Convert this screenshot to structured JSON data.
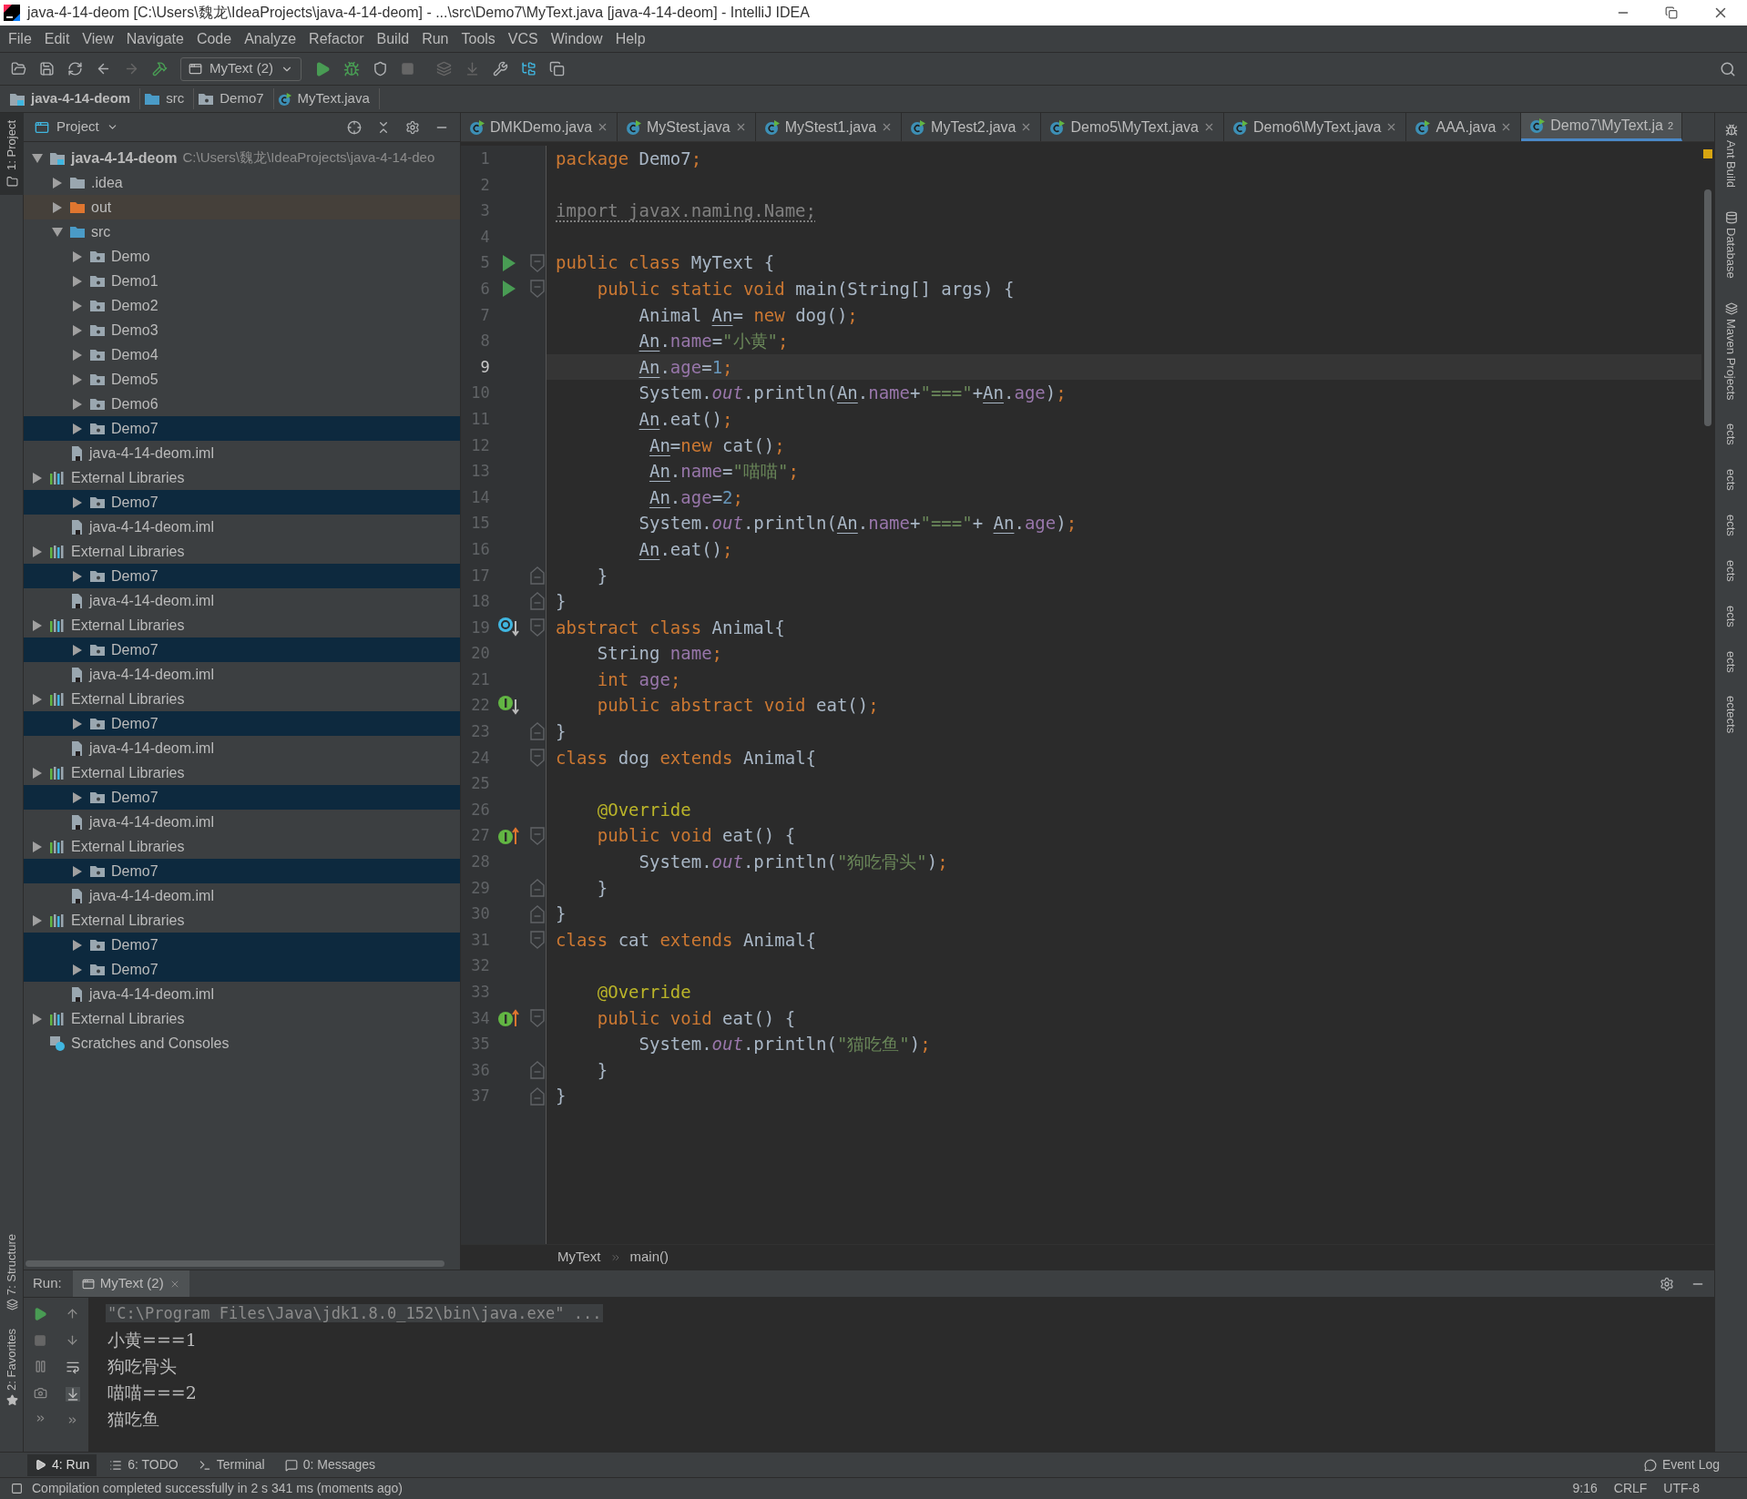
{
  "window": {
    "title": "java-4-14-deom [C:\\Users\\魏龙\\IdeaProjects\\java-4-14-deom] - ...\\src\\Demo7\\MyText.java [java-4-14-deom] - IntelliJ IDEA"
  },
  "menu": [
    "File",
    "Edit",
    "View",
    "Navigate",
    "Code",
    "Analyze",
    "Refactor",
    "Build",
    "Run",
    "Tools",
    "VCS",
    "Window",
    "Help"
  ],
  "toolbar": {
    "run_config": "MyText (2)"
  },
  "nav_bar": [
    {
      "kind": "module",
      "label": "java-4-14-deom"
    },
    {
      "kind": "source",
      "label": "src"
    },
    {
      "kind": "package",
      "label": "Demo7"
    },
    {
      "kind": "class",
      "label": "MyText.java"
    }
  ],
  "left_strip": {
    "top": [
      "1: Project"
    ],
    "bottom": [
      "7: Structure",
      "2: Favorites"
    ]
  },
  "project_panel": {
    "title": "Project",
    "tree": [
      {
        "kind": "root",
        "label": "java-4-14-deom",
        "path": "C:\\Users\\魏龙\\IdeaProjects\\java-4-14-deo",
        "expanded": true,
        "selected": false,
        "children": [
          {
            "kind": "folder",
            "label": ".idea",
            "expanded": false,
            "selected": false
          },
          {
            "kind": "excluded",
            "label": "out",
            "expanded": false,
            "selected": false
          },
          {
            "kind": "source",
            "label": "src",
            "expanded": true,
            "selected": false,
            "children": [
              {
                "kind": "package",
                "label": "Demo",
                "expanded": false,
                "selected": false
              },
              {
                "kind": "package",
                "label": "Demo1",
                "expanded": false,
                "selected": false
              },
              {
                "kind": "package",
                "label": "Demo2",
                "expanded": false,
                "selected": false
              },
              {
                "kind": "package",
                "label": "Demo3",
                "expanded": false,
                "selected": false
              },
              {
                "kind": "package",
                "label": "Demo4",
                "expanded": false,
                "selected": false
              },
              {
                "kind": "package",
                "label": "Demo5",
                "expanded": false,
                "selected": false
              },
              {
                "kind": "package",
                "label": "Demo6",
                "expanded": false,
                "selected": false
              },
              {
                "kind": "package",
                "label": "Demo7",
                "expanded": false,
                "selected": true
              }
            ]
          },
          {
            "kind": "iml",
            "label": "java-4-14-deom.iml",
            "selected": false
          }
        ]
      },
      {
        "kind": "library",
        "label": "External Libraries",
        "expanded": false,
        "selected": false
      },
      {
        "kind": "package",
        "label": "Demo7",
        "expanded": false,
        "selected": true
      },
      {
        "kind": "iml",
        "label": "java-4-14-deom.iml",
        "selected": false
      },
      {
        "kind": "library",
        "label": "External Libraries",
        "expanded": false,
        "selected": false
      },
      {
        "kind": "package",
        "label": "Demo7",
        "expanded": false,
        "selected": true
      },
      {
        "kind": "iml",
        "label": "java-4-14-deom.iml",
        "selected": false
      },
      {
        "kind": "library",
        "label": "External Libraries",
        "expanded": false,
        "selected": false
      },
      {
        "kind": "package",
        "label": "Demo7",
        "expanded": false,
        "selected": true
      },
      {
        "kind": "iml",
        "label": "java-4-14-deom.iml",
        "selected": false
      },
      {
        "kind": "library",
        "label": "External Libraries",
        "expanded": false,
        "selected": false
      },
      {
        "kind": "package",
        "label": "Demo7",
        "expanded": false,
        "selected": true
      },
      {
        "kind": "iml",
        "label": "java-4-14-deom.iml",
        "selected": false
      },
      {
        "kind": "library",
        "label": "External Libraries",
        "expanded": false,
        "selected": false
      },
      {
        "kind": "package",
        "label": "Demo7",
        "expanded": false,
        "selected": true
      },
      {
        "kind": "iml",
        "label": "java-4-14-deom.iml",
        "selected": false
      },
      {
        "kind": "library",
        "label": "External Libraries",
        "expanded": false,
        "selected": false
      },
      {
        "kind": "package",
        "label": "Demo7",
        "expanded": false,
        "selected": true
      },
      {
        "kind": "iml",
        "label": "java-4-14-deom.iml",
        "selected": false
      },
      {
        "kind": "library",
        "label": "External Libraries",
        "expanded": false,
        "selected": false
      },
      {
        "kind": "package",
        "label": "Demo7",
        "expanded": false,
        "selected": true
      },
      {
        "kind": "package",
        "label": "Demo7",
        "expanded": false,
        "selected": true
      },
      {
        "kind": "iml",
        "label": "java-4-14-deom.iml",
        "selected": false
      },
      {
        "kind": "library",
        "label": "External Libraries",
        "expanded": false,
        "selected": false
      },
      {
        "kind": "scratches",
        "label": "Scratches and Consoles",
        "selected": false
      }
    ]
  },
  "editor": {
    "tabs": [
      {
        "label": "DMKDemo.java",
        "selected": false
      },
      {
        "label": "MyStest.java",
        "selected": false
      },
      {
        "label": "MyStest1.java",
        "selected": false
      },
      {
        "label": "MyTest2.java",
        "selected": false
      },
      {
        "label": "Demo5\\MyText.java",
        "selected": false
      },
      {
        "label": "Demo6\\MyText.java",
        "selected": false
      },
      {
        "label": "AAA.java",
        "selected": false
      },
      {
        "label": "Demo7\\MyText.ja",
        "selected": true
      }
    ],
    "tab_overflow": "2",
    "lines": [
      {
        "number": "1",
        "current": false,
        "tokens": [
          {
            "kind": "kw",
            "text": "package"
          },
          {
            "kind": "plain",
            "text": " Demo7"
          },
          {
            "kind": "kw",
            "text": ";"
          }
        ]
      },
      {
        "number": "2",
        "current": false
      },
      {
        "number": "3",
        "current": false,
        "tokens": [
          {
            "kind": "unused",
            "text": "import javax.naming.Name;"
          }
        ]
      },
      {
        "number": "4",
        "current": false
      },
      {
        "number": "5",
        "current": false,
        "gutter_icon": {
          "kind": "run"
        },
        "fold_icon": {
          "kind": "open"
        },
        "tokens": [
          {
            "kind": "kw",
            "text": "public class"
          },
          {
            "kind": "plain",
            "text": " MyText {"
          }
        ]
      },
      {
        "number": "6",
        "current": false,
        "gutter_icon": {
          "kind": "run"
        },
        "fold_icon": {
          "kind": "open"
        },
        "tokens": [
          {
            "kind": "kw",
            "text": "    public static void"
          },
          {
            "kind": "plain",
            "text": " main(String[] args) {"
          }
        ]
      },
      {
        "number": "7",
        "current": false,
        "tokens": [
          {
            "kind": "plain",
            "text": "        Animal "
          },
          {
            "kind": "var",
            "text": "An"
          },
          {
            "kind": "plain",
            "text": "= "
          },
          {
            "kind": "kw",
            "text": "new"
          },
          {
            "kind": "plain",
            "text": " dog()"
          },
          {
            "kind": "kw",
            "text": ";"
          }
        ]
      },
      {
        "number": "8",
        "current": false,
        "tokens": [
          {
            "kind": "var",
            "text": "        An"
          },
          {
            "kind": "plain",
            "text": "."
          },
          {
            "kind": "field",
            "text": "name"
          },
          {
            "kind": "plain",
            "text": "="
          },
          {
            "kind": "str",
            "text": "\"小黄\""
          },
          {
            "kind": "kw",
            "text": ";"
          }
        ]
      },
      {
        "number": "9",
        "current": true,
        "tokens": [
          {
            "kind": "var",
            "text": "        An"
          },
          {
            "kind": "plain",
            "text": "."
          },
          {
            "kind": "field",
            "text": "age"
          },
          {
            "kind": "plain",
            "text": "="
          },
          {
            "kind": "num",
            "text": "1"
          },
          {
            "kind": "kw",
            "text": ";"
          }
        ]
      },
      {
        "number": "10",
        "current": false,
        "tokens": [
          {
            "kind": "plain",
            "text": "        System."
          },
          {
            "kind": "static",
            "text": "out"
          },
          {
            "kind": "plain",
            "text": ".println("
          },
          {
            "kind": "var",
            "text": "An"
          },
          {
            "kind": "plain",
            "text": "."
          },
          {
            "kind": "field",
            "text": "name"
          },
          {
            "kind": "plain",
            "text": "+"
          },
          {
            "kind": "str",
            "text": "\"===\""
          },
          {
            "kind": "plain",
            "text": "+"
          },
          {
            "kind": "var",
            "text": "An"
          },
          {
            "kind": "plain",
            "text": "."
          },
          {
            "kind": "field",
            "text": "age"
          },
          {
            "kind": "plain",
            "text": ")"
          },
          {
            "kind": "kw",
            "text": ";"
          }
        ]
      },
      {
        "number": "11",
        "current": false,
        "tokens": [
          {
            "kind": "var",
            "text": "        An"
          },
          {
            "kind": "plain",
            "text": ".eat()"
          },
          {
            "kind": "kw",
            "text": ";"
          }
        ]
      },
      {
        "number": "12",
        "current": false,
        "tokens": [
          {
            "kind": "var",
            "text": "         An"
          },
          {
            "kind": "plain",
            "text": "="
          },
          {
            "kind": "kw",
            "text": "new"
          },
          {
            "kind": "plain",
            "text": " cat()"
          },
          {
            "kind": "kw",
            "text": ";"
          }
        ]
      },
      {
        "number": "13",
        "current": false,
        "tokens": [
          {
            "kind": "var",
            "text": "         An"
          },
          {
            "kind": "plain",
            "text": "."
          },
          {
            "kind": "field",
            "text": "name"
          },
          {
            "kind": "plain",
            "text": "="
          },
          {
            "kind": "str",
            "text": "\"喵喵\""
          },
          {
            "kind": "kw",
            "text": ";"
          }
        ]
      },
      {
        "number": "14",
        "current": false,
        "tokens": [
          {
            "kind": "var",
            "text": "         An"
          },
          {
            "kind": "plain",
            "text": "."
          },
          {
            "kind": "field",
            "text": "age"
          },
          {
            "kind": "plain",
            "text": "="
          },
          {
            "kind": "num",
            "text": "2"
          },
          {
            "kind": "kw",
            "text": ";"
          }
        ]
      },
      {
        "number": "15",
        "current": false,
        "tokens": [
          {
            "kind": "plain",
            "text": "        System."
          },
          {
            "kind": "static",
            "text": "out"
          },
          {
            "kind": "plain",
            "text": ".println("
          },
          {
            "kind": "var",
            "text": "An"
          },
          {
            "kind": "plain",
            "text": "."
          },
          {
            "kind": "field",
            "text": "name"
          },
          {
            "kind": "plain",
            "text": "+"
          },
          {
            "kind": "str",
            "text": "\"===\""
          },
          {
            "kind": "plain",
            "text": "+"
          },
          {
            "kind": "var",
            "text": " An"
          },
          {
            "kind": "plain",
            "text": "."
          },
          {
            "kind": "field",
            "text": "age"
          },
          {
            "kind": "plain",
            "text": ")"
          },
          {
            "kind": "kw",
            "text": ";"
          }
        ]
      },
      {
        "number": "16",
        "current": false,
        "tokens": [
          {
            "kind": "var",
            "text": "        An"
          },
          {
            "kind": "plain",
            "text": ".eat()"
          },
          {
            "kind": "kw",
            "text": ";"
          }
        ]
      },
      {
        "number": "17",
        "current": false,
        "fold_icon": {
          "kind": "close"
        },
        "tokens": [
          {
            "kind": "plain",
            "text": "    }"
          }
        ]
      },
      {
        "number": "18",
        "current": false,
        "fold_icon": {
          "kind": "close"
        },
        "tokens": [
          {
            "kind": "plain",
            "text": "}"
          }
        ]
      },
      {
        "number": "19",
        "current": false,
        "gutter_icon": {
          "kind": "overridden"
        },
        "fold_icon": {
          "kind": "open"
        },
        "tokens": [
          {
            "kind": "kw",
            "text": "abstract class"
          },
          {
            "kind": "plain",
            "text": " Animal{"
          }
        ]
      },
      {
        "number": "20",
        "current": false,
        "tokens": [
          {
            "kind": "plain",
            "text": "    String "
          },
          {
            "kind": "field",
            "text": "name"
          },
          {
            "kind": "kw",
            "text": ";"
          }
        ]
      },
      {
        "number": "21",
        "current": false,
        "tokens": [
          {
            "kind": "kw",
            "text": "    int"
          },
          {
            "kind": "field",
            "text": " age"
          },
          {
            "kind": "kw",
            "text": ";"
          }
        ]
      },
      {
        "number": "22",
        "current": false,
        "gutter_icon": {
          "kind": "implemented"
        },
        "tokens": [
          {
            "kind": "kw",
            "text": "    public abstract void"
          },
          {
            "kind": "plain",
            "text": " eat()"
          },
          {
            "kind": "kw",
            "text": ";"
          }
        ]
      },
      {
        "number": "23",
        "current": false,
        "fold_icon": {
          "kind": "close"
        },
        "tokens": [
          {
            "kind": "plain",
            "text": "}"
          }
        ]
      },
      {
        "number": "24",
        "current": false,
        "fold_icon": {
          "kind": "open"
        },
        "tokens": [
          {
            "kind": "kw",
            "text": "class"
          },
          {
            "kind": "plain",
            "text": " dog "
          },
          {
            "kind": "kw",
            "text": "extends"
          },
          {
            "kind": "plain",
            "text": " Animal{"
          }
        ]
      },
      {
        "number": "25",
        "current": false
      },
      {
        "number": "26",
        "current": false,
        "tokens": [
          {
            "kind": "annot",
            "text": "    @Override"
          }
        ]
      },
      {
        "number": "27",
        "current": false,
        "gutter_icon": {
          "kind": "implementing"
        },
        "fold_icon": {
          "kind": "open"
        },
        "tokens": [
          {
            "kind": "kw",
            "text": "    public void"
          },
          {
            "kind": "plain",
            "text": " eat() {"
          }
        ]
      },
      {
        "number": "28",
        "current": false,
        "tokens": [
          {
            "kind": "plain",
            "text": "        System."
          },
          {
            "kind": "static",
            "text": "out"
          },
          {
            "kind": "plain",
            "text": ".println("
          },
          {
            "kind": "str",
            "text": "\"狗吃骨头\""
          },
          {
            "kind": "plain",
            "text": ")"
          },
          {
            "kind": "kw",
            "text": ";"
          }
        ]
      },
      {
        "number": "29",
        "current": false,
        "fold_icon": {
          "kind": "close"
        },
        "tokens": [
          {
            "kind": "plain",
            "text": "    }"
          }
        ]
      },
      {
        "number": "30",
        "current": false,
        "fold_icon": {
          "kind": "close"
        },
        "tokens": [
          {
            "kind": "plain",
            "text": "}"
          }
        ]
      },
      {
        "number": "31",
        "current": false,
        "fold_icon": {
          "kind": "open"
        },
        "tokens": [
          {
            "kind": "kw",
            "text": "class"
          },
          {
            "kind": "plain",
            "text": " cat "
          },
          {
            "kind": "kw",
            "text": "extends"
          },
          {
            "kind": "plain",
            "text": " Animal{"
          }
        ]
      },
      {
        "number": "32",
        "current": false
      },
      {
        "number": "33",
        "current": false,
        "tokens": [
          {
            "kind": "annot",
            "text": "    @Override"
          }
        ]
      },
      {
        "number": "34",
        "current": false,
        "gutter_icon": {
          "kind": "implementing"
        },
        "fold_icon": {
          "kind": "open"
        },
        "tokens": [
          {
            "kind": "kw",
            "text": "    public void"
          },
          {
            "kind": "plain",
            "text": " eat() {"
          }
        ]
      },
      {
        "number": "35",
        "current": false,
        "tokens": [
          {
            "kind": "plain",
            "text": "        System."
          },
          {
            "kind": "static",
            "text": "out"
          },
          {
            "kind": "plain",
            "text": ".println("
          },
          {
            "kind": "str",
            "text": "\"猫吃鱼\""
          },
          {
            "kind": "plain",
            "text": ")"
          },
          {
            "kind": "kw",
            "text": ";"
          }
        ]
      },
      {
        "number": "36",
        "current": false,
        "fold_icon": {
          "kind": "close"
        },
        "tokens": [
          {
            "kind": "plain",
            "text": "    }"
          }
        ]
      },
      {
        "number": "37",
        "current": false,
        "fold_icon": {
          "kind": "close"
        },
        "tokens": [
          {
            "kind": "plain",
            "text": "}"
          }
        ]
      }
    ],
    "breadcrumb": [
      "MyText",
      "main()"
    ]
  },
  "right_strip": [
    {
      "kind": "ant",
      "label": "Ant Build"
    },
    {
      "kind": "database",
      "label": "Database"
    },
    {
      "kind": "maven",
      "label": "Maven Projects"
    },
    {
      "kind": "plain",
      "label": "ects"
    },
    {
      "kind": "plain",
      "label": "ects"
    },
    {
      "kind": "plain",
      "label": "ects"
    },
    {
      "kind": "plain",
      "label": "ects"
    },
    {
      "kind": "plain",
      "label": "ects"
    },
    {
      "kind": "plain",
      "label": "ects"
    },
    {
      "kind": "plain",
      "label": "ectects"
    }
  ],
  "run_panel": {
    "label": "Run:",
    "tab": "MyText (2)",
    "console": [
      {
        "kind": "command",
        "text": "\"C:\\Program Files\\Java\\jdk1.8.0_152\\bin\\java.exe\" ..."
      },
      {
        "kind": "output",
        "text": "小黄===1"
      },
      {
        "kind": "output",
        "text": "狗吃骨头"
      },
      {
        "kind": "output",
        "text": "喵喵===2"
      },
      {
        "kind": "output",
        "text": "猫吃鱼"
      }
    ]
  },
  "tool_tabs": [
    {
      "kind": "run",
      "label": "4: Run",
      "selected": true
    },
    {
      "kind": "todo",
      "label": "6: TODO",
      "selected": false
    },
    {
      "kind": "terminal",
      "label": "Terminal",
      "selected": false
    },
    {
      "kind": "messages",
      "label": "0: Messages",
      "selected": false
    }
  ],
  "event_log": "Event Log",
  "status_bar": {
    "message": "Compilation completed successfully in 2 s 341 ms (moments ago)",
    "items": [
      "9:16",
      "CRLF",
      "UTF-8"
    ]
  }
}
